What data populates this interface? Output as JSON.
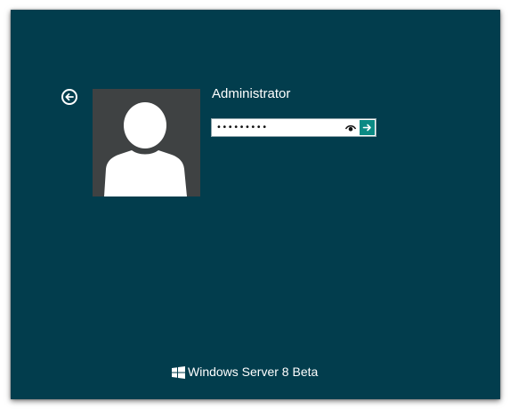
{
  "login": {
    "username": "Administrator",
    "password_mask": "•••••••••",
    "reveal_icon": "eye-icon",
    "submit_icon": "arrow-right-icon",
    "back_icon": "back-arrow-icon",
    "avatar_icon": "user-silhouette"
  },
  "branding": {
    "product": "Windows Server 8 Beta",
    "logo_icon": "windows-logo"
  },
  "colors": {
    "background": "#023d4d",
    "avatar_bg": "#3f4243",
    "submit_button": "#0b8a84"
  }
}
